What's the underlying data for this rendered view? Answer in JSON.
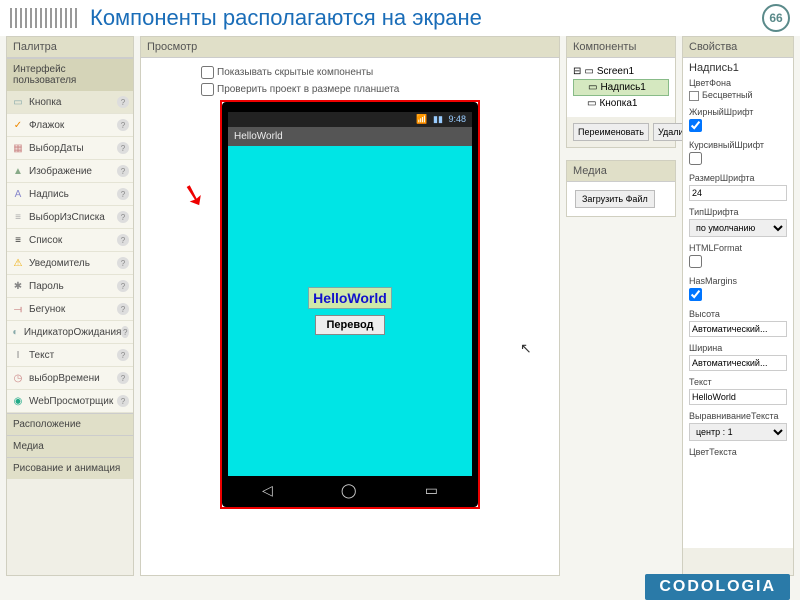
{
  "header": {
    "title": "Компоненты располагаются на экране",
    "slide_num": "66"
  },
  "palette": {
    "title": "Палитра",
    "categories": {
      "ui": "Интерфейс пользователя",
      "layout": "Расположение",
      "media": "Медиа",
      "drawing": "Рисование и анимация"
    },
    "items": [
      {
        "label": "Кнопка",
        "icon": "▭",
        "color": "#8aa"
      },
      {
        "label": "Флажок",
        "icon": "✓",
        "color": "#e80"
      },
      {
        "label": "ВыборДаты",
        "icon": "▦",
        "color": "#c88"
      },
      {
        "label": "Изображение",
        "icon": "▲",
        "color": "#8a8"
      },
      {
        "label": "Надпись",
        "icon": "A",
        "color": "#88c"
      },
      {
        "label": "ВыборИзСписка",
        "icon": "≡",
        "color": "#aaa"
      },
      {
        "label": "Список",
        "icon": "≡",
        "color": "#333"
      },
      {
        "label": "Уведомитель",
        "icon": "⚠",
        "color": "#ea0"
      },
      {
        "label": "Пароль",
        "icon": "✱",
        "color": "#888"
      },
      {
        "label": "Бегунок",
        "icon": "⟞",
        "color": "#c88"
      },
      {
        "label": "ИндикаторОжидания",
        "icon": "◐",
        "color": "#8aa"
      },
      {
        "label": "Текст",
        "icon": "I",
        "color": "#888"
      },
      {
        "label": "выборВремени",
        "icon": "◷",
        "color": "#c88"
      },
      {
        "label": "WebПросмотрщик",
        "icon": "◉",
        "color": "#2a8"
      }
    ]
  },
  "viewer": {
    "title": "Просмотр",
    "chk_hidden": "Показывать скрытые компоненты",
    "chk_size": "Проверить проект в размере планшета",
    "status_time": "9:48",
    "app_title": "HelloWorld",
    "label_text": "HelloWorld",
    "button_text": "Перевод"
  },
  "components": {
    "title": "Компоненты",
    "tree": [
      {
        "label": "Screen1",
        "level": 0,
        "sel": false
      },
      {
        "label": "Надпись1",
        "level": 1,
        "sel": true
      },
      {
        "label": "Кнопка1",
        "level": 1,
        "sel": false
      }
    ],
    "rename": "Переименовать",
    "delete": "Удалить",
    "media_title": "Медиа",
    "upload": "Загрузить Файл"
  },
  "props": {
    "title": "Свойства",
    "selected": "Надпись1",
    "bgcolor_label": "ЦветФона",
    "bgcolor_val": "Бесцветный",
    "bold_label": "ЖирныйШрифт",
    "bold_val": true,
    "italic_label": "КурсивныйШрифт",
    "italic_val": false,
    "fontsize_label": "РазмерШрифта",
    "fontsize_val": "24",
    "fonttype_label": "ТипШрифта",
    "fonttype_val": "по умолчанию",
    "htmlformat_label": "HTMLFormat",
    "htmlformat_val": false,
    "hasmargins_label": "HasMargins",
    "hasmargins_val": true,
    "height_label": "Высота",
    "height_val": "Автоматический...",
    "width_label": "Ширина",
    "width_val": "Автоматический...",
    "text_label": "Текст",
    "text_val": "HelloWorld",
    "align_label": "ВыравниваниеТекста",
    "align_val": "центр : 1",
    "textcolor_label": "ЦветТекста"
  },
  "footer": "CODOLOGIA"
}
